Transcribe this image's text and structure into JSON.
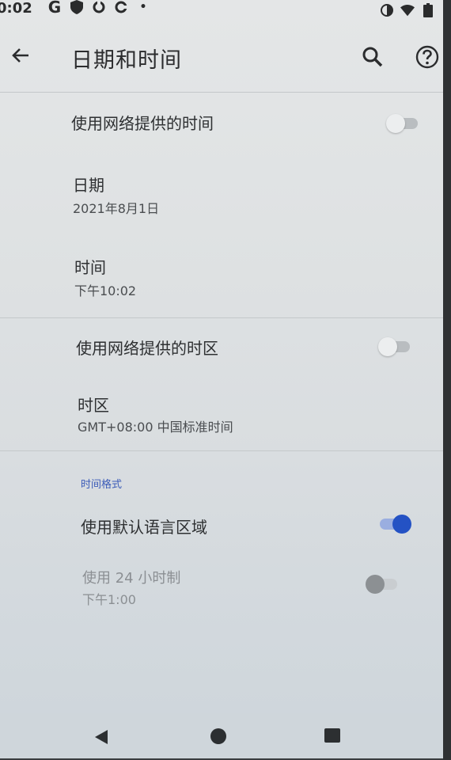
{
  "status_bar": {
    "time": "0:02",
    "left_icons": [
      "google-g-icon",
      "shield-icon",
      "sync-icon",
      "sync-icon",
      "dot-icon"
    ],
    "right_icons": [
      "data-saver-icon",
      "wifi-icon",
      "battery-icon"
    ],
    "google_glyph": "G",
    "dot_glyph": "•"
  },
  "app_bar": {
    "title": "日期和时间"
  },
  "settings": {
    "network_time": {
      "label": "使用网络提供的时间",
      "enabled": false
    },
    "date": {
      "label": "日期",
      "value": "2021年8月1日"
    },
    "time": {
      "label": "时间",
      "value": "下午10:02"
    },
    "network_timezone": {
      "label": "使用网络提供的时区",
      "enabled": false
    },
    "timezone": {
      "label": "时区",
      "value": "GMT+08:00 中国标准时间"
    },
    "time_format_header": "时间格式",
    "use_locale_default": {
      "label": "使用默认语言区域",
      "enabled": true
    },
    "use_24_hour": {
      "label": "使用 24 小时制",
      "value": "下午1:00",
      "enabled": false,
      "disabled": true
    }
  },
  "colors": {
    "accent": "#2452c4",
    "section_header": "#3b5bb8",
    "background": "#dfe2e3"
  }
}
